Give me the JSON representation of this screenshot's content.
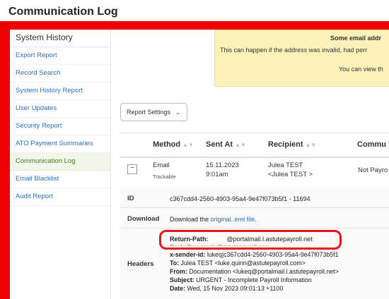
{
  "page_title": "Communication Log",
  "sidebar": {
    "heading": "System History",
    "items": [
      {
        "label": "Export Report"
      },
      {
        "label": "Record Search"
      },
      {
        "label": "System History Report"
      },
      {
        "label": "User Updates"
      },
      {
        "label": "Security Report"
      },
      {
        "label": "ATO Payment Summaries"
      },
      {
        "label": "Communication Log"
      },
      {
        "label": "Email Blacklist"
      },
      {
        "label": "Audit Report"
      }
    ],
    "active": "Communication Log"
  },
  "warning": {
    "title": "Some email addr",
    "line1": "This can happen if the address was invalid, had perr",
    "line2": "You can view th"
  },
  "report_settings": {
    "label": "Report Settings"
  },
  "table": {
    "columns": [
      "Method",
      "Sent At",
      "Recipient",
      "Commu"
    ],
    "row": {
      "method": "Email",
      "method_sub": "Trackable",
      "sent_date": "15.11.2023",
      "sent_time": "9:01am",
      "recipient_name": "Julea TEST",
      "recipient_email": "<Julea TEST >",
      "communication": "Not Payro"
    }
  },
  "detail": {
    "id_label": "ID",
    "id_value": "c367cdd4-2560-4903-95a4-9e47f073b5f1 - 11694",
    "download_label": "Download",
    "download_prefix": "Download the ",
    "download_link": "original..eml file",
    "download_suffix": ".",
    "headers_label": "Headers",
    "return_path_key": "Return-Path:",
    "return_path_value": "@portalmail.l.astutepayroll.net",
    "reply_to_partial": "Reply-To: noreply@astutepayroll.com",
    "x_sender_key": "x-sender-id:",
    "x_sender_value": "lukeq|c367cdd4-2560-4903-95a4-9e47f073b5f1",
    "to_key": "To:",
    "to_value": "Julea TEST <luke.quinn@astutepayroll.com>",
    "from_key": "From:",
    "from_value": "Documentation <lukeq@portalmail.l.astutepayroll.net>",
    "subject_key": "Subject:",
    "subject_value": "URGENT - Incomplete Payroll Information",
    "date_key": "Date:",
    "date_value": "Wed, 15 Nov 2023 09:01:13 +1100"
  },
  "colors": {
    "frame": "#ee0000",
    "highlight": "#e8151b",
    "warning_bg": "#fcf1b8",
    "link": "#2a6fc4"
  }
}
